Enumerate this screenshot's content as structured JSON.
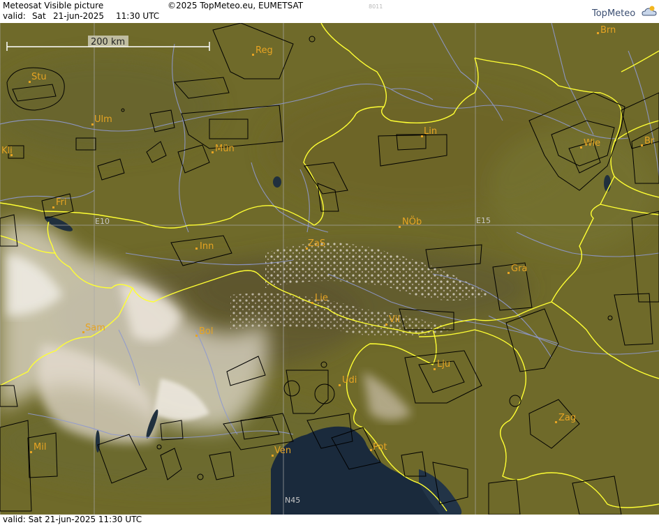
{
  "header": {
    "title": "Meteosat Visible picture",
    "copyright": "©2025 TopMeteo.eu, EUMETSAT",
    "code": "8011",
    "valid_label": "valid:",
    "valid_day": "Sat",
    "valid_date": "21-jun-2025",
    "valid_time": "11:30 UTC",
    "logo": "TopMeteo"
  },
  "footer": {
    "valid_text": "valid:  Sat  21-jun-2025  11:30 UTC"
  },
  "scale_bar": {
    "label": "200 km"
  },
  "grid_labels": {
    "e10": "E10",
    "e15": "E15",
    "n45": "N45"
  },
  "cities": [
    {
      "id": "reg",
      "label": "Reg"
    },
    {
      "id": "brn",
      "label": "Brn"
    },
    {
      "id": "stu",
      "label": "Stu"
    },
    {
      "id": "ulm",
      "label": "Ulm"
    },
    {
      "id": "mun",
      "label": "Mün"
    },
    {
      "id": "lin",
      "label": "Lin"
    },
    {
      "id": "wie",
      "label": "Wie"
    },
    {
      "id": "bra",
      "label": "Br"
    },
    {
      "id": "kli",
      "label": "Kli"
    },
    {
      "id": "fri",
      "label": "Fri"
    },
    {
      "id": "nob",
      "label": "NÖb"
    },
    {
      "id": "inn",
      "label": "Inn"
    },
    {
      "id": "zas",
      "label": "ZaS"
    },
    {
      "id": "gra",
      "label": "Gra"
    },
    {
      "id": "lie",
      "label": "Lie"
    },
    {
      "id": "vil",
      "label": "Vil"
    },
    {
      "id": "sam",
      "label": "Sam"
    },
    {
      "id": "bol",
      "label": "Bol"
    },
    {
      "id": "lju",
      "label": "Lju"
    },
    {
      "id": "udi",
      "label": "Udi"
    },
    {
      "id": "zag",
      "label": "Zag"
    },
    {
      "id": "mil",
      "label": "Mil"
    },
    {
      "id": "ven",
      "label": "Ven"
    },
    {
      "id": "pot",
      "label": "Pot"
    }
  ],
  "colors": {
    "land": "#6f6a2a",
    "border": "#ffff33",
    "river": "#8f9ad0",
    "airspace": "#000000",
    "city": "#e7a423",
    "sea": "#1a2a3c"
  }
}
